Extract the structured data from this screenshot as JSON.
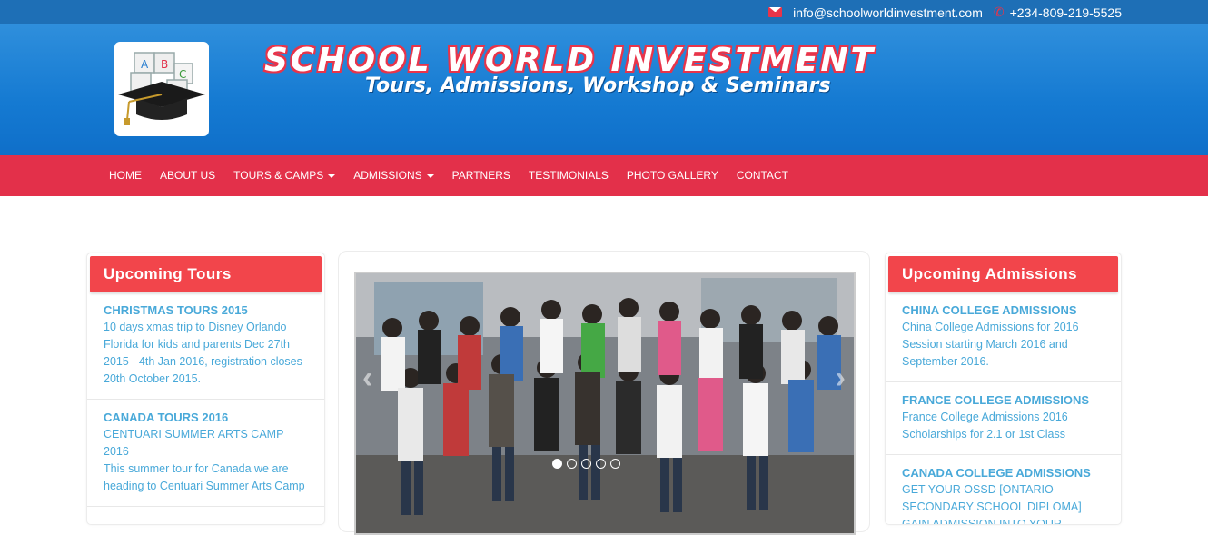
{
  "topbar": {
    "email": "info@schoolworldinvestment.com",
    "phone": "+234-809-219-5525"
  },
  "header": {
    "title": "SCHOOL WORLD INVESTMENT",
    "subtitle": "Tours, Admissions, Workshop & Seminars"
  },
  "nav": {
    "home": "HOME",
    "about": "ABOUT US",
    "tours": "TOURS & CAMPS",
    "admissions": "ADMISSIONS",
    "partners": "PARTNERS",
    "testimonials": "TESTIMONIALS",
    "gallery": "PHOTO GALLERY",
    "contact": "CONTACT"
  },
  "tours": {
    "heading": "Upcoming Tours",
    "items": [
      {
        "title": "CHRISTMAS TOURS 2015",
        "text": "10 days xmas trip to Disney Orlando Florida for kids and parents Dec 27th 2015 - 4th Jan 2016, registration closes 20th October 2015."
      },
      {
        "title": "CANADA TOURS 2016",
        "text": "CENTUARI SUMMER ARTS CAMP 2016",
        "text2": "This summer tour for Canada we are heading to Centuari Summer Arts Camp"
      }
    ]
  },
  "admissions": {
    "heading": "Upcoming Admissions",
    "items": [
      {
        "title": "CHINA COLLEGE ADMISSIONS",
        "text": "China College Admissions for 2016 Session starting March 2016 and September 2016."
      },
      {
        "title": "FRANCE COLLEGE ADMISSIONS",
        "text": "France College Admissions 2016 Scholarships for 2.1 or 1st Class"
      },
      {
        "title": "CANADA COLLEGE ADMISSIONS",
        "text": "GET YOUR OSSD [ONTARIO SECONDARY SCHOOL DIPLOMA] GAIN ADMISSION INTO YOUR"
      }
    ]
  },
  "slider": {
    "prev": "‹",
    "next": "›",
    "slide_count": 5,
    "active_slide": 1
  },
  "colors": {
    "topbar": "#1e6fb6",
    "header": "#157ad2",
    "nav": "#e3304a",
    "panel_heading": "#f2454b",
    "link_text": "#49a9d9"
  },
  "icons": {
    "email": "envelope-icon",
    "phone": "phone-icon",
    "logo": "graduation-cap-blocks-logo"
  }
}
